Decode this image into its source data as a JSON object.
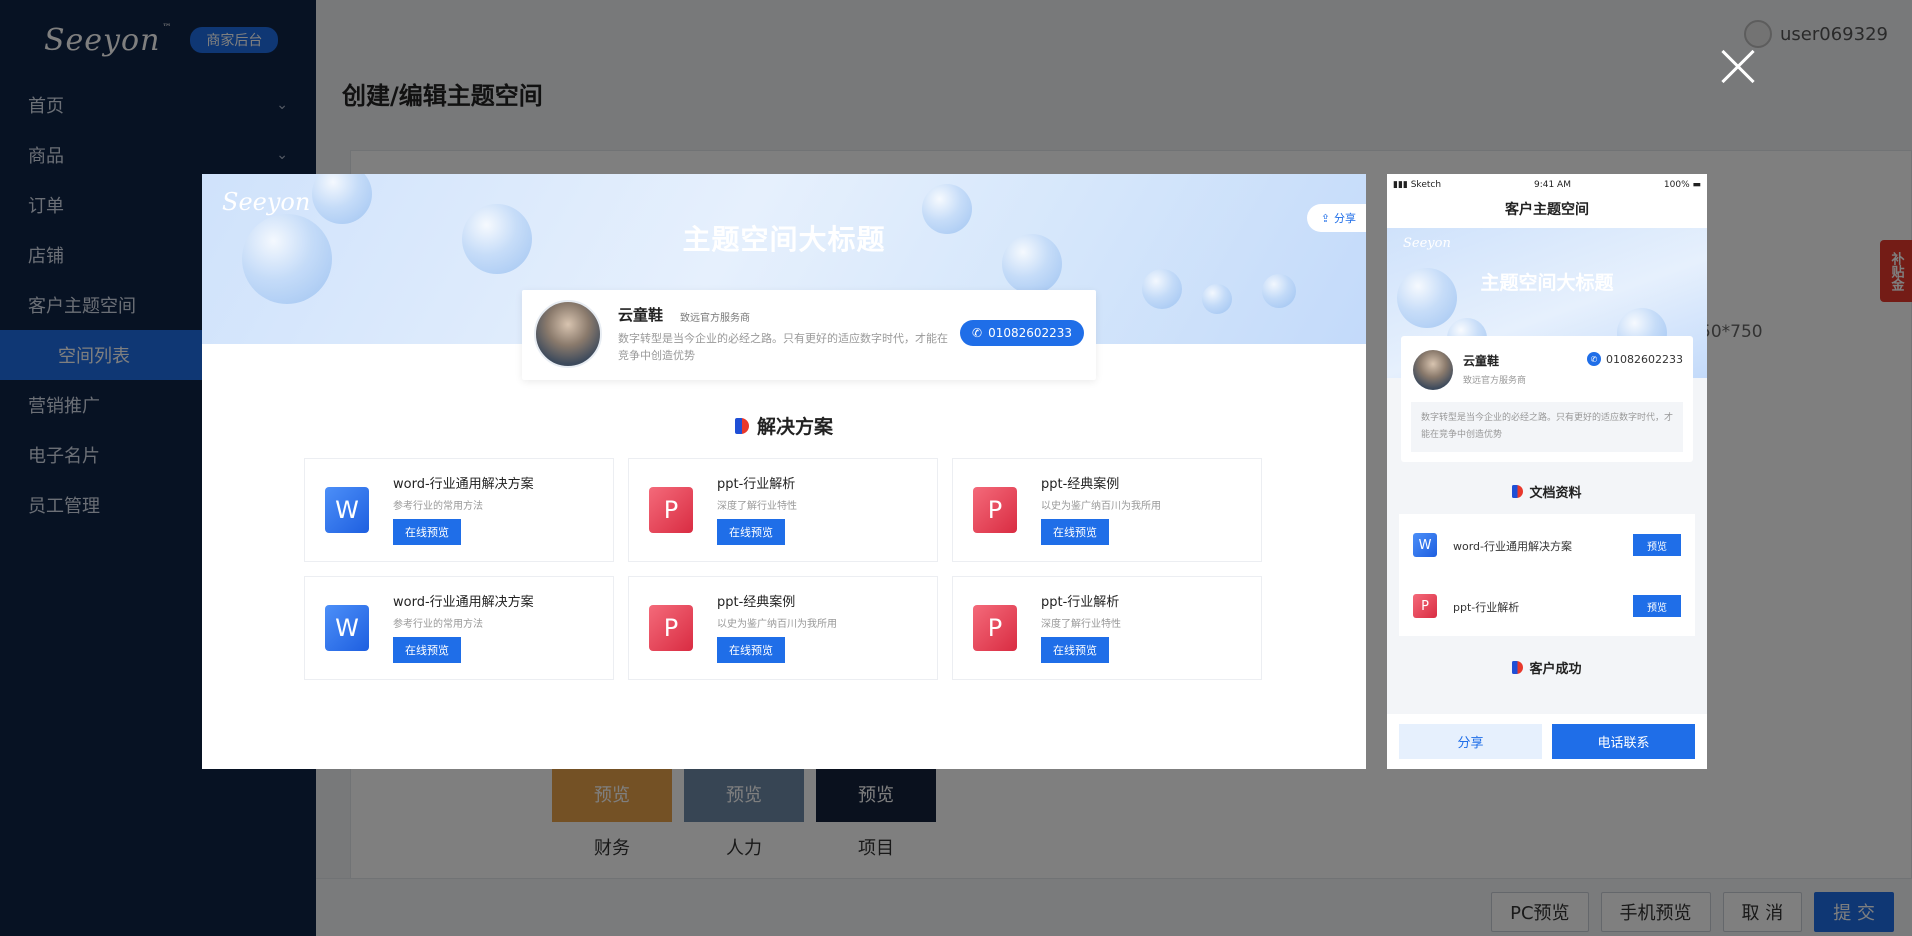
{
  "sidebar": {
    "logo": "Seeyon",
    "logo_tm": "™",
    "badge": "商家后台",
    "items": [
      {
        "label": "首页",
        "chevron": true
      },
      {
        "label": "商品",
        "chevron": true
      },
      {
        "label": "订单",
        "chevron": false
      },
      {
        "label": "店铺",
        "chevron": false
      },
      {
        "label": "客户主题空间",
        "chevron": false
      }
    ],
    "active_sub": "空间列表",
    "items_after": [
      {
        "label": "营销推广"
      },
      {
        "label": "电子名片"
      },
      {
        "label": "员工管理"
      }
    ]
  },
  "topbar": {
    "username": "user069329"
  },
  "page": {
    "title": "创建/编辑主题空间",
    "size_hint": "50*750",
    "thumbs": [
      {
        "overlay": "预览",
        "label": "财务",
        "color": "#e8a24a"
      },
      {
        "overlay": "预览",
        "label": "人力",
        "color": "#6f8aa8"
      },
      {
        "overlay": "预览",
        "label": "项目",
        "color": "#15223d"
      }
    ],
    "buttons": {
      "pc_preview": "PC预览",
      "mobile_preview": "手机预览",
      "cancel": "取 消",
      "submit": "提 交"
    },
    "side_tag": "补贴金"
  },
  "pc_preview": {
    "logo": "Seeyon",
    "title": "主题空间大标题",
    "share": "分享",
    "card": {
      "name": "云童鞋",
      "role": "致远官方服务商",
      "desc": "数字转型是当今企业的必经之路。只有更好的适应数字时代，才能在竞争中创造优势",
      "phone": "01082602233"
    },
    "section_title": "解决方案",
    "docs": [
      {
        "type": "word",
        "icon": "W",
        "title": "word-行业通用解决方案",
        "sub": "参考行业的常用方法",
        "btn": "在线预览"
      },
      {
        "type": "ppt",
        "icon": "P",
        "title": "ppt-行业解析",
        "sub": "深度了解行业特性",
        "btn": "在线预览"
      },
      {
        "type": "ppt",
        "icon": "P",
        "title": "ppt-经典案例",
        "sub": "以史为鉴广纳百川为我所用",
        "btn": "在线预览"
      },
      {
        "type": "word",
        "icon": "W",
        "title": "word-行业通用解决方案",
        "sub": "参考行业的常用方法",
        "btn": "在线预览"
      },
      {
        "type": "ppt",
        "icon": "P",
        "title": "ppt-经典案例",
        "sub": "以史为鉴广纳百川为我所用",
        "btn": "在线预览"
      },
      {
        "type": "ppt",
        "icon": "P",
        "title": "ppt-行业解析",
        "sub": "深度了解行业特性",
        "btn": "在线预览"
      }
    ]
  },
  "mobile_preview": {
    "status": {
      "carrier": "Sketch",
      "time": "9:41 AM",
      "battery": "100%"
    },
    "nav_title": "客户主题空间",
    "logo": "Seeyon",
    "title": "主题空间大标题",
    "card": {
      "name": "云童鞋",
      "role": "致远官方服务商",
      "phone": "01082602233",
      "desc": "数字转型是当今企业的必经之路。只有更好的适应数字时代，才能在竞争中创造优势"
    },
    "section_docs": "文档资料",
    "docs": [
      {
        "type": "word",
        "icon": "W",
        "title": "word-行业通用解决方案",
        "btn": "预览"
      },
      {
        "type": "ppt",
        "icon": "P",
        "title": "ppt-行业解析",
        "btn": "预览"
      }
    ],
    "section_success": "客户成功",
    "share_btn": "分享",
    "call_btn": "电话联系"
  }
}
